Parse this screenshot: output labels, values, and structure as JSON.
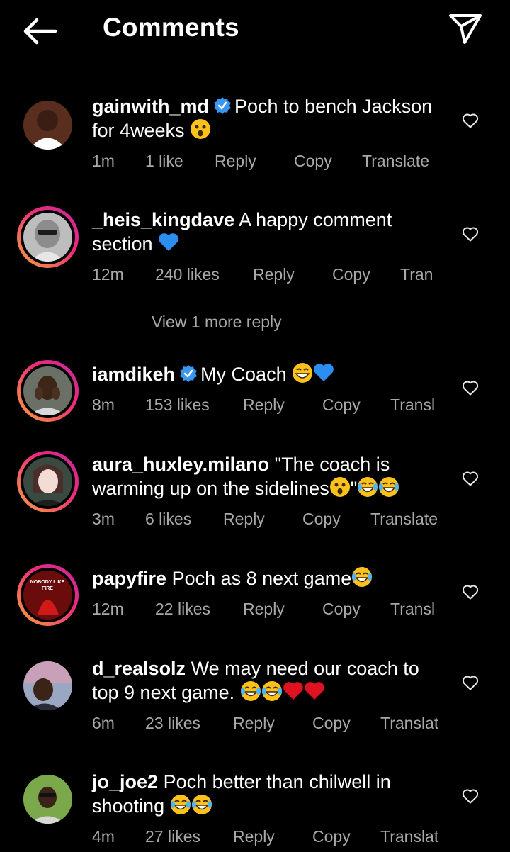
{
  "header": {
    "title": "Comments",
    "back_icon": "back-arrow-icon",
    "share_icon": "direct-send-icon"
  },
  "comments": [
    {
      "username": "gainwith_md",
      "verified": true,
      "text": "Poch to bench Jackson for 4weeks",
      "emojis": [
        "astonished"
      ],
      "time": "1m",
      "likes": "1 like",
      "reply": "Reply",
      "copy": "Copy",
      "translate": "Translate"
    },
    {
      "username": "_heis_kingdave",
      "verified": false,
      "text": "A happy comment section",
      "emojis": [
        "blue-heart"
      ],
      "time": "12m",
      "likes": "240 likes",
      "reply": "Reply",
      "copy": "Copy",
      "translate": "Tran"
    },
    {
      "username": "iamdikeh",
      "verified": true,
      "text": "My Coach",
      "emojis": [
        "grin",
        "blue-heart"
      ],
      "time": "8m",
      "likes": "153 likes",
      "reply": "Reply",
      "copy": "Copy",
      "translate": "Transl"
    },
    {
      "username": "aura_huxley.milano",
      "verified": false,
      "text": "\"The coach is warming up on the sidelines",
      "text_end": "\"",
      "emojis": [
        "astonished",
        "joy",
        "joy"
      ],
      "time": "3m",
      "likes": "6 likes",
      "reply": "Reply",
      "copy": "Copy",
      "translate": "Translate"
    },
    {
      "username": "papyfire",
      "verified": false,
      "text": "Poch as 8 next game",
      "emojis": [
        "joy"
      ],
      "time": "12m",
      "likes": "22 likes",
      "reply": "Reply",
      "copy": "Copy",
      "translate": "Transl"
    },
    {
      "username": "d_realsolz",
      "verified": false,
      "text": "We may need our coach to top 9 next game.",
      "emojis": [
        "joy",
        "joy",
        "red-heart",
        "red-heart"
      ],
      "time": "6m",
      "likes": "23 likes",
      "reply": "Reply",
      "copy": "Copy",
      "translate": "Translat"
    },
    {
      "username": "jo_joe2",
      "verified": false,
      "text": "Poch better than chilwell in shooting",
      "emojis": [
        "joy",
        "joy"
      ],
      "time": "4m",
      "likes": "27 likes",
      "reply": "Reply",
      "copy": "Copy",
      "translate": "Translat"
    }
  ],
  "view_more": "View 1 more reply",
  "avatar_art": {
    "papyfire_line1": "NOBODY LIKE",
    "papyfire_line2": "FIRE"
  }
}
